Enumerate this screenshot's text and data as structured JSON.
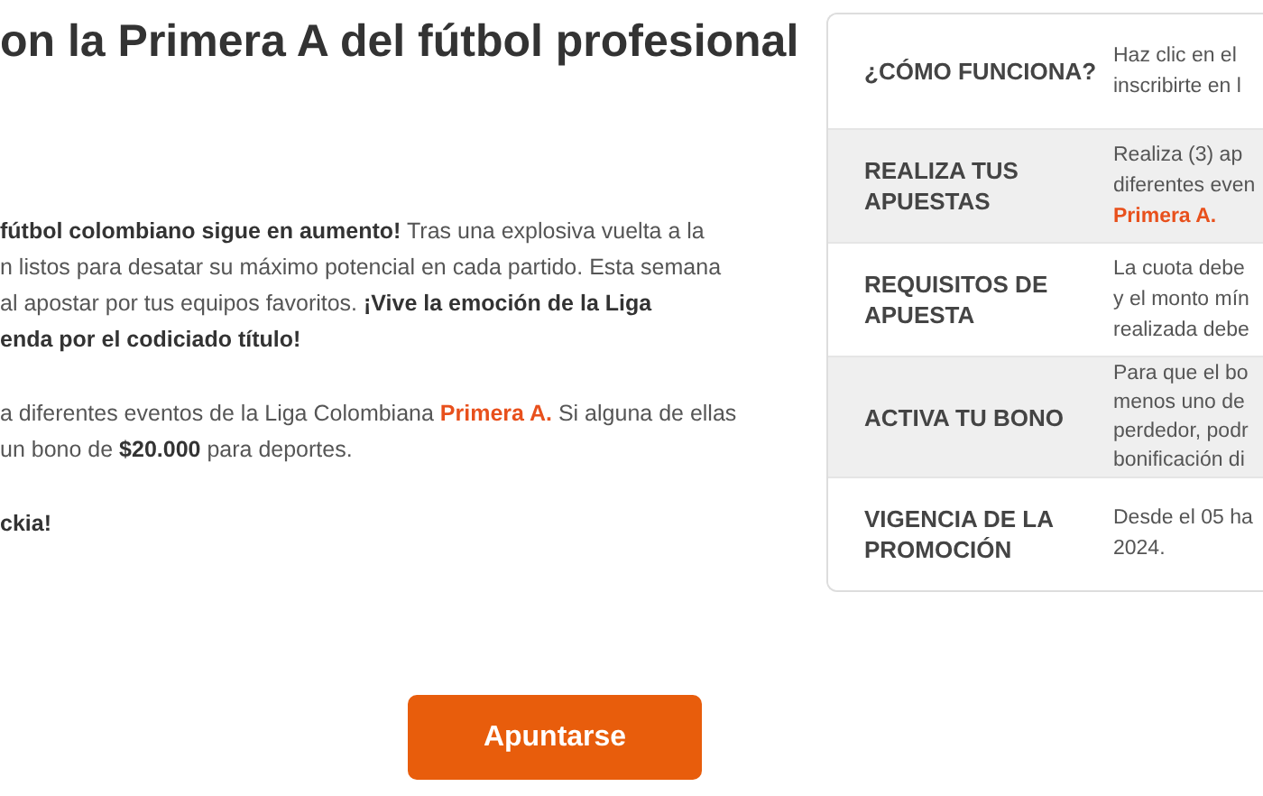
{
  "heading": "on la Primera A del fútbol profesional",
  "paragraphs": [
    {
      "lines": [
        "**fútbol colombiano sigue en aumento!** Tras una explosiva vuelta a la",
        "n listos para desatar su máximo potencial en cada partido. Esta semana",
        "al apostar por tus equipos favoritos. **¡Vive la emoción de la Liga**",
        "**enda por el codiciado título!**"
      ],
      "accent": false
    },
    {
      "lines": [
        "a diferentes eventos de la Liga Colombiana **Primera A.** Si alguna de ellas",
        "un bono de **$20.000** para deportes."
      ],
      "accent": true
    },
    {
      "lines": [
        "**ckia!**"
      ],
      "accent": false
    }
  ],
  "steps": [
    {
      "label": "¿CÓMO FUNCIONA?",
      "shaded": false,
      "lines": [
        "Haz clic en el",
        "inscribirte en l"
      ]
    },
    {
      "label": "REALIZA TUS APUESTAS",
      "shaded": true,
      "lines": [
        "Realiza (3) ap",
        "diferentes even",
        "**Primera A.**"
      ]
    },
    {
      "label": "REQUISITOS DE APUESTA",
      "shaded": false,
      "lines": [
        "La cuota debe",
        "y el monto mín",
        "realizada debe"
      ]
    },
    {
      "label": "ACTIVA TU BONO",
      "shaded": true,
      "lines": [
        "Para que el bo",
        "menos uno de",
        "perdedor, podr",
        "bonificación di"
      ]
    },
    {
      "label": "VIGENCIA DE LA PROMOCIÓN",
      "shaded": false,
      "lines": [
        "Desde el 05 ha",
        "2024."
      ]
    }
  ],
  "button": "Apuntarse"
}
